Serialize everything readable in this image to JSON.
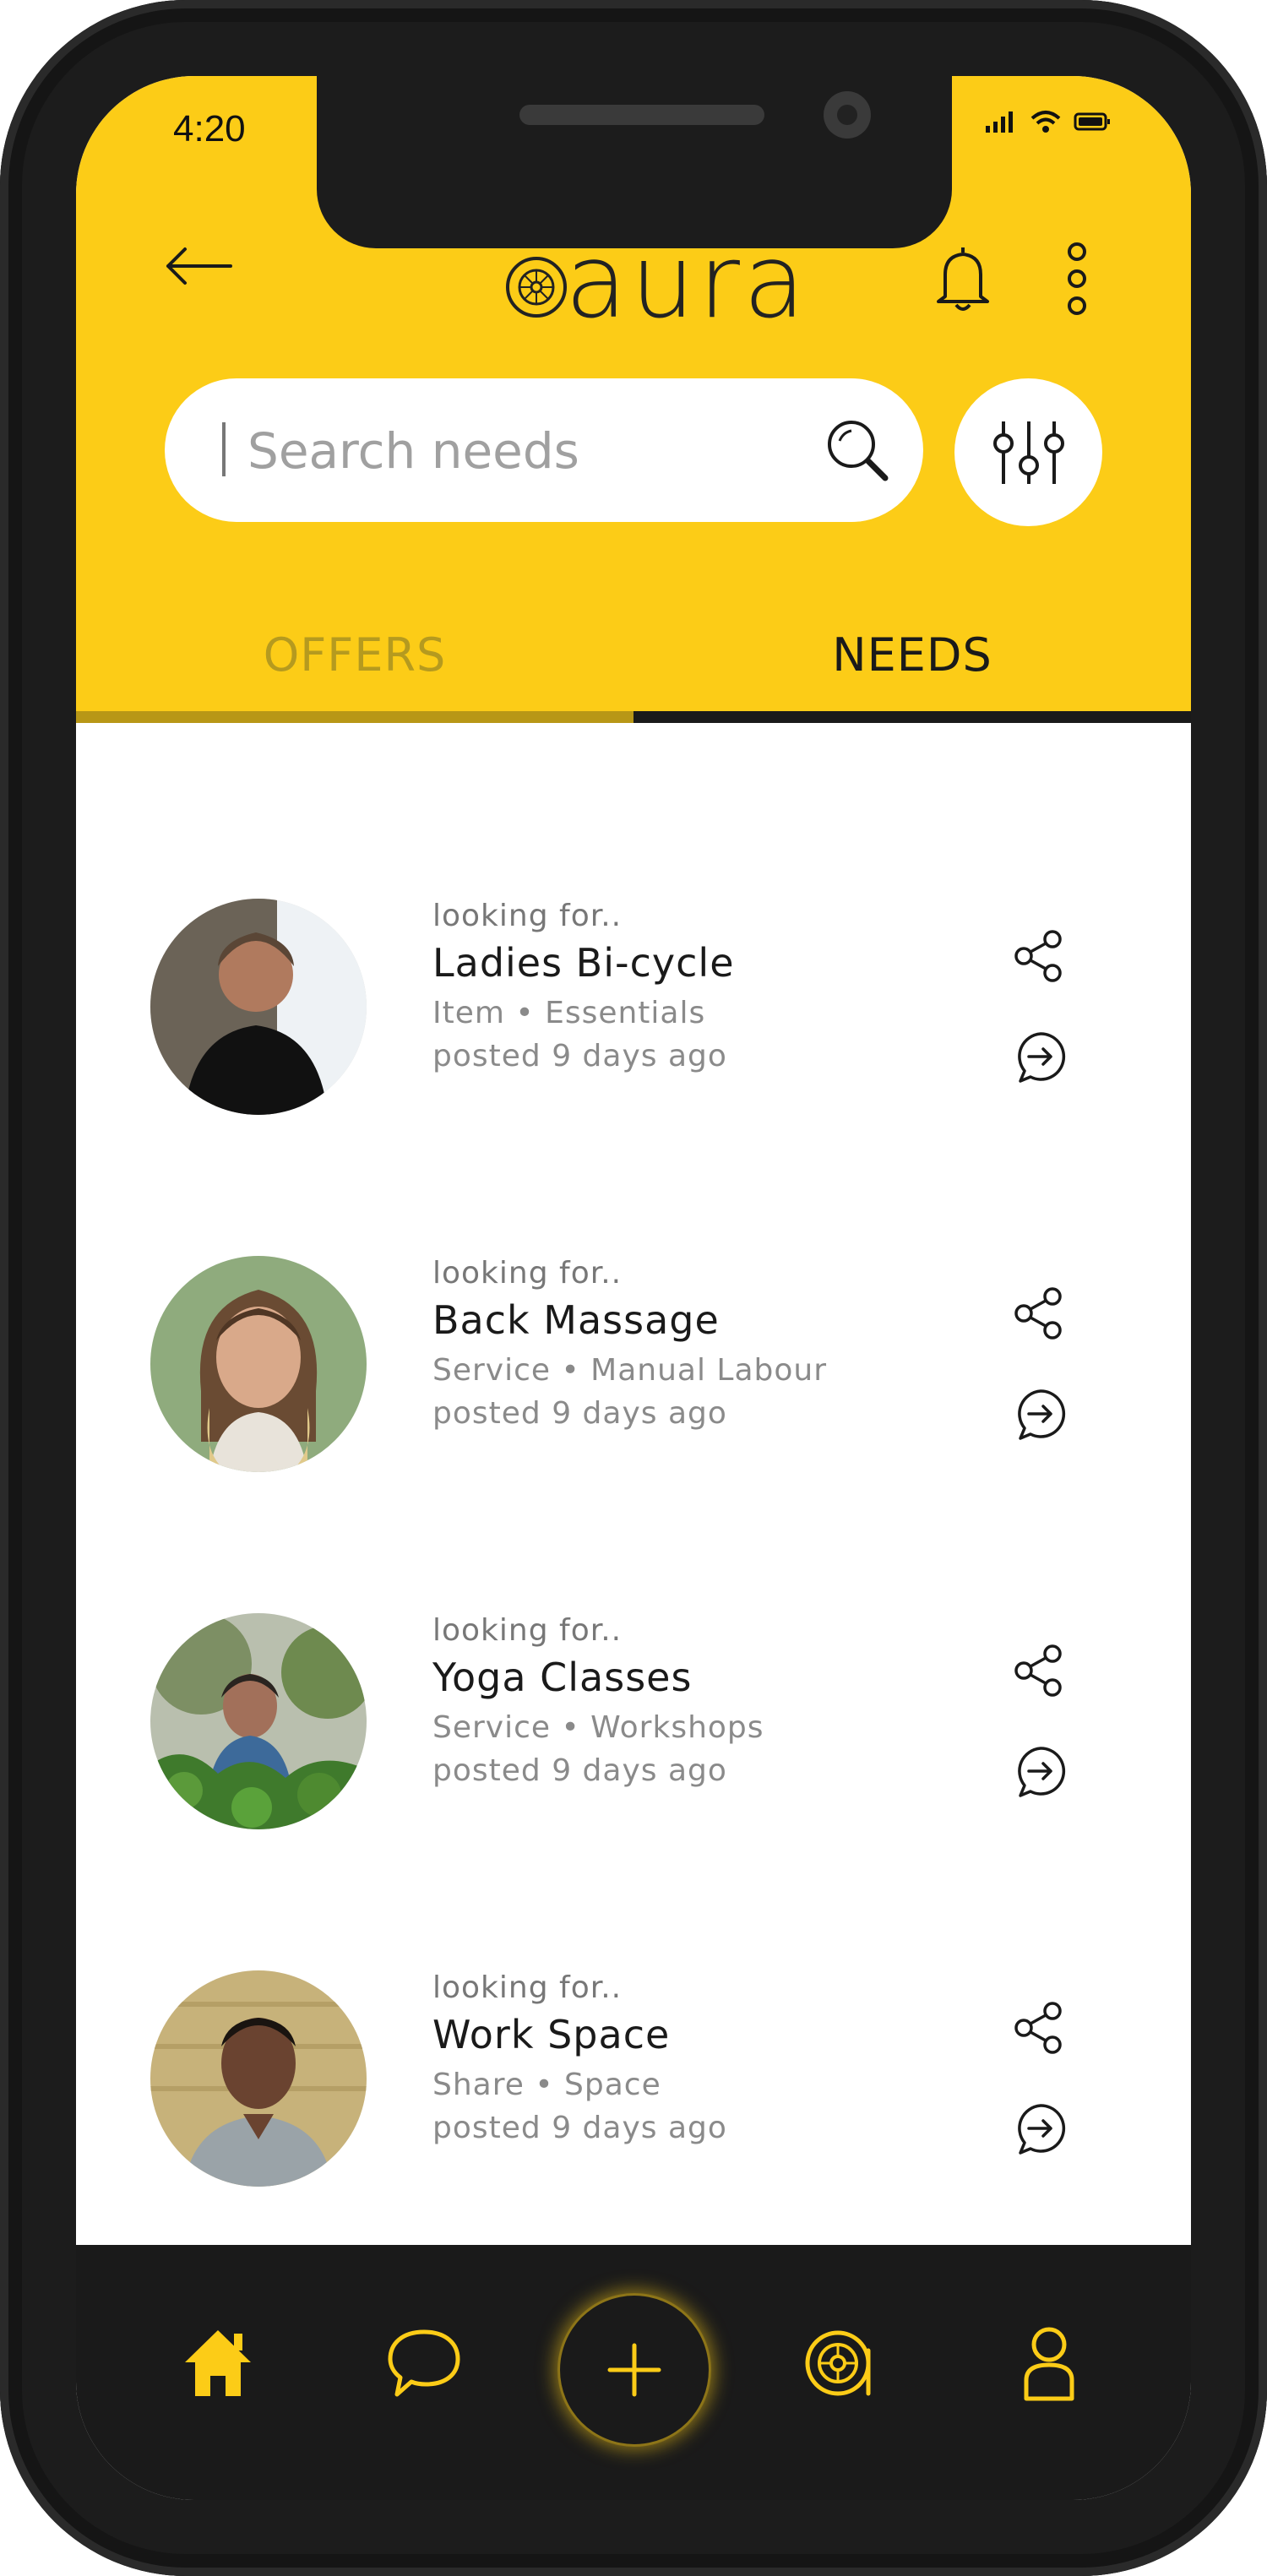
{
  "status_bar": {
    "time": "4:20"
  },
  "header": {
    "logo_text": "aura",
    "back_label": "back",
    "bell_label": "notifications",
    "menu_label": "more"
  },
  "search": {
    "placeholder": "Search needs",
    "value": ""
  },
  "tabs": [
    {
      "label": "OFFERS",
      "active": false
    },
    {
      "label": "NEEDS",
      "active": true
    }
  ],
  "items": [
    {
      "prefix": "looking for..",
      "title": "Ladies Bi-cycle",
      "meta": "Item • Essentials",
      "posted": "posted 9 days ago",
      "avatar_color": "#6b6357"
    },
    {
      "prefix": "looking for..",
      "title": "Back Massage",
      "meta": "Service • Manual Labour",
      "posted": "posted 9 days ago",
      "avatar_color": "#8fab7d"
    },
    {
      "prefix": "looking for..",
      "title": "Yoga Classes",
      "meta": "Service • Workshops",
      "posted": "posted 9 days ago",
      "avatar_color": "#4f7a3a"
    },
    {
      "prefix": "looking for..",
      "title": "Work Space",
      "meta": "Share • Space",
      "posted": "posted 9 days ago",
      "avatar_color": "#c7b27a"
    }
  ],
  "bottom_nav": [
    {
      "icon": "home-icon",
      "active": true
    },
    {
      "icon": "chat-icon",
      "active": false
    },
    {
      "icon": "add-icon",
      "active": false
    },
    {
      "icon": "aura-icon",
      "active": false
    },
    {
      "icon": "profile-icon",
      "active": false
    }
  ],
  "colors": {
    "accent": "#FCCC17",
    "dark": "#1a1a1a",
    "muted_tab": "#9e8a22"
  }
}
